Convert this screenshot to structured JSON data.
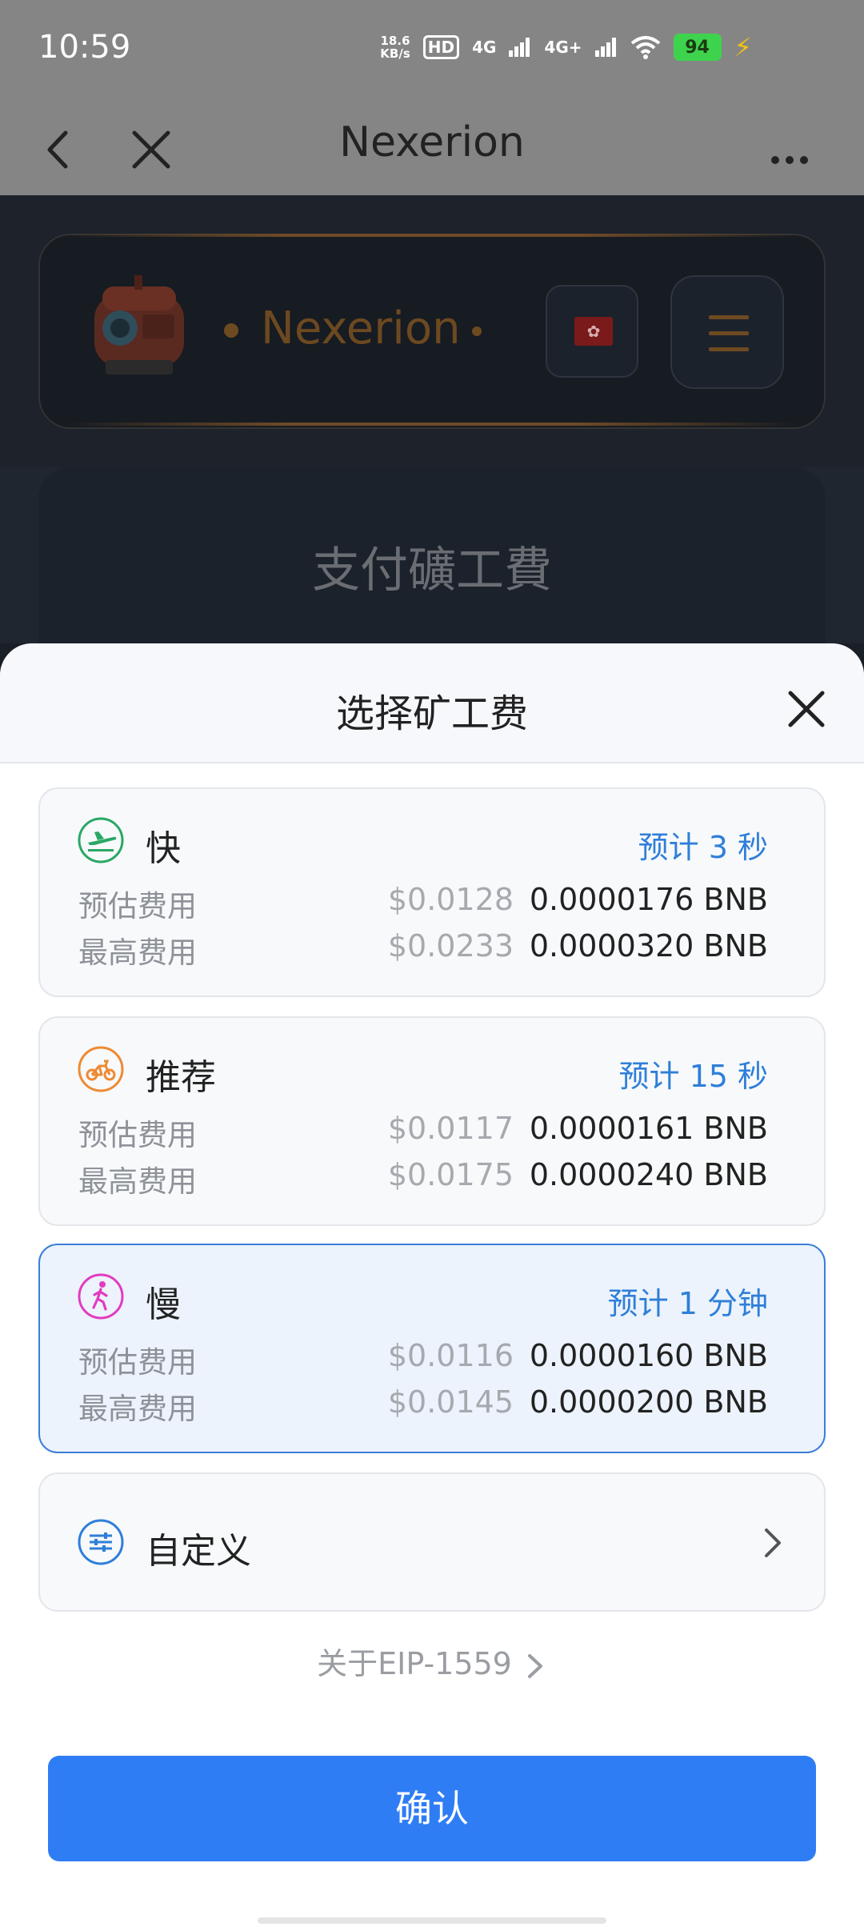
{
  "status_bar": {
    "time": "10:59",
    "net_speed_value": "18.6",
    "net_speed_unit": "KB/s",
    "hd_badge": "HD",
    "signal_1": "4G",
    "signal_2": "4G+",
    "battery": "94",
    "icons": [
      "wifi-icon",
      "signal-icon",
      "battery-icon",
      "charging-icon"
    ]
  },
  "nav": {
    "title": "Nexerion",
    "icons": [
      "back-icon",
      "close-icon",
      "more-icon"
    ]
  },
  "page": {
    "brand": "Nexerion",
    "language_flag": "hong-kong-flag",
    "pay_title": "支付礦工費"
  },
  "sheet": {
    "title": "选择矿工费",
    "options": [
      {
        "name": "快",
        "eta": "预计 3 秒",
        "icon": "plane-icon",
        "est_label": "预估费用",
        "est_usd": "$0.0128",
        "est_bnb": "0.0000176 BNB",
        "max_label": "最高费用",
        "max_usd": "$0.0233",
        "max_bnb": "0.0000320 BNB"
      },
      {
        "name": "推荐",
        "eta": "预计 15 秒",
        "icon": "bike-icon",
        "est_label": "预估费用",
        "est_usd": "$0.0117",
        "est_bnb": "0.0000161 BNB",
        "max_label": "最高费用",
        "max_usd": "$0.0175",
        "max_bnb": "0.0000240 BNB"
      },
      {
        "name": "慢",
        "eta": "预计 1 分钟",
        "icon": "walk-icon",
        "est_label": "预估费用",
        "est_usd": "$0.0116",
        "est_bnb": "0.0000160 BNB",
        "max_label": "最高费用",
        "max_usd": "$0.0145",
        "max_bnb": "0.0000200 BNB",
        "selected": true
      }
    ],
    "custom_label": "自定义",
    "eip_link": "关于EIP-1559",
    "confirm": "确认"
  },
  "colors": {
    "accent": "#2f7df5",
    "eta_blue": "#2f7fd8",
    "fast_green": "#2aa765",
    "recommend_orange": "#ee8a32",
    "slow_pink": "#e23bc0"
  }
}
